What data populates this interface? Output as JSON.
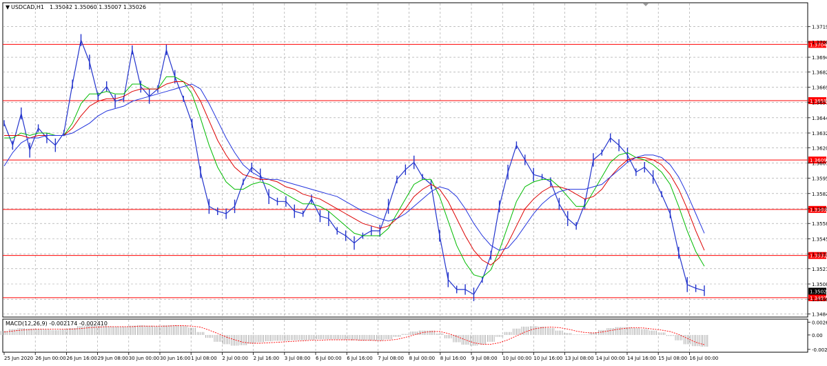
{
  "header": {
    "symbol_tf": "USDCAD,H1",
    "ohlc": "1.35042 1.35060 1.35007 1.35026"
  },
  "macd": {
    "label": "MACD(12,26,9) -0.002174 -0.002410",
    "ticks": [
      "0.002628",
      "0.00",
      "-0.00296"
    ],
    "tick_values": [
      0.002628,
      0.0,
      -0.00296
    ],
    "ylim": [
      -0.0034,
      0.0031
    ]
  },
  "colors": {
    "price": "#2233cc",
    "ma_fast": "#00bb00",
    "ma_mid": "#dd0000",
    "ma_slow": "#2233dd",
    "level": "#ff0000",
    "macd_line": "#ff0000",
    "macd_hist": "#9a9a9a",
    "grid": "#9a9a9a"
  },
  "chart_data": {
    "type": "line",
    "symbol": "USDCAD",
    "timeframe": "H1",
    "ylim": [
      1.3482,
      1.3738
    ],
    "y_ticks": [
      "1.37190",
      "1.37065",
      "1.36940",
      "1.36820",
      "1.36695",
      "1.36570",
      "1.36445",
      "1.36320",
      "1.36200",
      "1.36075",
      "1.35950",
      "1.35825",
      "1.35700",
      "1.35580",
      "1.35455",
      "1.35330",
      "1.35210",
      "1.35085",
      "1.34960",
      "1.34840"
    ],
    "y_tick_values": [
      1.3719,
      1.37065,
      1.3694,
      1.3682,
      1.36695,
      1.3657,
      1.36445,
      1.3632,
      1.362,
      1.36075,
      1.3595,
      1.35825,
      1.357,
      1.3558,
      1.35455,
      1.3533,
      1.3521,
      1.35085,
      1.3496,
      1.3484
    ],
    "x_ticks": [
      "25 Jun 2020",
      "26 Jun 00:00",
      "26 Jun 16:00",
      "29 Jun 08:00",
      "30 Jun 00:00",
      "30 Jun 16:00",
      "1 Jul 08:00",
      "2 Jul 00:00",
      "2 Jul 16:00",
      "3 Jul 08:00",
      "6 Jul 00:00",
      "6 Jul 16:00",
      "7 Jul 08:00",
      "8 Jul 00:00",
      "8 Jul 16:00",
      "9 Jul 08:00",
      "10 Jul 00:00",
      "10 Jul 16:00",
      "13 Jul 08:00",
      "14 Jul 00:00",
      "14 Jul 16:00",
      "15 Jul 08:00",
      "16 Jul 00:00"
    ],
    "levels": [
      {
        "label": "1.37045",
        "value": 1.37045
      },
      {
        "label": "1.36585",
        "value": 1.36585
      },
      {
        "label": "1.36099",
        "value": 1.36099
      },
      {
        "label": "1.35695",
        "value": 1.35695
      },
      {
        "label": "1.35318",
        "value": 1.35318
      },
      {
        "label": "1.34973",
        "value": 1.34973
      }
    ],
    "current_price": {
      "label": "1.35026",
      "value": 1.35026
    },
    "series": [
      {
        "values": [
          1.364,
          1.3622,
          1.3648,
          1.3618,
          1.3636,
          1.3628,
          1.3622,
          1.3632,
          1.3672,
          1.3708,
          1.369,
          1.3662,
          1.367,
          1.3658,
          1.366,
          1.37,
          1.367,
          1.3662,
          1.3668,
          1.37,
          1.3678,
          1.366,
          1.364,
          1.36,
          1.3572,
          1.3568,
          1.3566,
          1.3572,
          1.3592,
          1.3604,
          1.3598,
          1.358,
          1.3576,
          1.3576,
          1.3568,
          1.3566,
          1.3578,
          1.3564,
          1.3562,
          1.3552,
          1.3548,
          1.3542,
          1.3548,
          1.3552,
          1.3552,
          1.3572,
          1.3594,
          1.3602,
          1.3608,
          1.3596,
          1.359,
          1.3548,
          1.3512,
          1.3504,
          1.3504,
          1.35,
          1.3512,
          1.3532,
          1.3572,
          1.36,
          1.3622,
          1.361,
          1.3598,
          1.3596,
          1.3592,
          1.3574,
          1.3562,
          1.3556,
          1.3574,
          1.361,
          1.3616,
          1.3628,
          1.3622,
          1.3614,
          1.36,
          1.3604,
          1.3596,
          1.3582,
          1.3566,
          1.3534,
          1.3508,
          1.3505,
          1.3503
        ]
      },
      {
        "values": [
          1.3628,
          1.3628,
          1.3632,
          1.363,
          1.3632,
          1.3632,
          1.363,
          1.363,
          1.364,
          1.3656,
          1.3664,
          1.3664,
          1.3666,
          1.3664,
          1.3664,
          1.3672,
          1.3672,
          1.3668,
          1.3668,
          1.3678,
          1.3678,
          1.3674,
          1.3664,
          1.3644,
          1.3622,
          1.3604,
          1.3592,
          1.3586,
          1.3586,
          1.359,
          1.3592,
          1.359,
          1.3586,
          1.3582,
          1.3578,
          1.3574,
          1.3574,
          1.3572,
          1.3568,
          1.3562,
          1.3556,
          1.355,
          1.3548,
          1.3548,
          1.3548,
          1.3554,
          1.3566,
          1.3578,
          1.359,
          1.3594,
          1.3594,
          1.358,
          1.356,
          1.354,
          1.3526,
          1.3516,
          1.3514,
          1.352,
          1.3536,
          1.3556,
          1.3576,
          1.3588,
          1.3592,
          1.3594,
          1.3594,
          1.3588,
          1.358,
          1.3572,
          1.3572,
          1.3584,
          1.3596,
          1.3608,
          1.3614,
          1.3616,
          1.3612,
          1.361,
          1.3606,
          1.36,
          1.359,
          1.3572,
          1.3552,
          1.3535,
          1.3523
        ]
      },
      {
        "values": [
          1.363,
          1.363,
          1.363,
          1.3628,
          1.363,
          1.363,
          1.363,
          1.363,
          1.3636,
          1.3646,
          1.3654,
          1.3658,
          1.366,
          1.366,
          1.3662,
          1.3666,
          1.3668,
          1.3668,
          1.3668,
          1.3672,
          1.3674,
          1.3674,
          1.367,
          1.3658,
          1.3642,
          1.3626,
          1.3614,
          1.3604,
          1.3598,
          1.3596,
          1.3594,
          1.3594,
          1.3592,
          1.3588,
          1.3586,
          1.3582,
          1.358,
          1.3578,
          1.3574,
          1.357,
          1.3566,
          1.3562,
          1.3558,
          1.3556,
          1.3554,
          1.3556,
          1.3562,
          1.357,
          1.358,
          1.3586,
          1.359,
          1.3586,
          1.3576,
          1.3562,
          1.3548,
          1.3536,
          1.3528,
          1.3524,
          1.353,
          1.3542,
          1.3556,
          1.357,
          1.3578,
          1.3584,
          1.3588,
          1.3588,
          1.3586,
          1.3582,
          1.3578,
          1.358,
          1.3586,
          1.3596,
          1.3604,
          1.361,
          1.3612,
          1.3612,
          1.361,
          1.3606,
          1.3598,
          1.3586,
          1.357,
          1.3552,
          1.3536
        ]
      },
      {
        "values": [
          1.3605,
          1.3616,
          1.3624,
          1.3628,
          1.3628,
          1.363,
          1.363,
          1.363,
          1.3632,
          1.3636,
          1.364,
          1.3646,
          1.365,
          1.3652,
          1.3654,
          1.3658,
          1.366,
          1.3662,
          1.3664,
          1.3666,
          1.3668,
          1.367,
          1.3672,
          1.3668,
          1.3656,
          1.3642,
          1.3628,
          1.3616,
          1.3606,
          1.36,
          1.3596,
          1.3594,
          1.3594,
          1.3592,
          1.359,
          1.3588,
          1.3586,
          1.3584,
          1.3582,
          1.358,
          1.3576,
          1.3572,
          1.3568,
          1.3565,
          1.3562,
          1.356,
          1.3562,
          1.3566,
          1.3572,
          1.3578,
          1.3584,
          1.3588,
          1.3586,
          1.358,
          1.357,
          1.3558,
          1.3548,
          1.354,
          1.3536,
          1.3538,
          1.3546,
          1.3556,
          1.3566,
          1.3574,
          1.358,
          1.3584,
          1.3586,
          1.3586,
          1.3586,
          1.3588,
          1.359,
          1.3596,
          1.3602,
          1.3608,
          1.3612,
          1.3614,
          1.3614,
          1.3612,
          1.3606,
          1.3596,
          1.3582,
          1.3566,
          1.355
        ]
      }
    ],
    "macd_hist": [
      0.0008,
      0.0012,
      0.0014,
      0.0013,
      0.0012,
      0.0011,
      0.001,
      0.0011,
      0.0014,
      0.0018,
      0.002,
      0.0019,
      0.0018,
      0.0017,
      0.0017,
      0.0019,
      0.002,
      0.0019,
      0.0018,
      0.002,
      0.002,
      0.0019,
      0.0015,
      0.0006,
      -0.0006,
      -0.0014,
      -0.0019,
      -0.0022,
      -0.0021,
      -0.0018,
      -0.0015,
      -0.0013,
      -0.0012,
      -0.0012,
      -0.0011,
      -0.0011,
      -0.001,
      -0.0009,
      -0.0009,
      -0.0009,
      -0.001,
      -0.0011,
      -0.0012,
      -0.0012,
      -0.0012,
      -0.0009,
      -0.0004,
      0.0002,
      0.0007,
      0.0009,
      0.0009,
      0.0003,
      -0.0007,
      -0.0015,
      -0.002,
      -0.0022,
      -0.002,
      -0.0014,
      -0.0004,
      0.0006,
      0.0013,
      0.0017,
      0.0018,
      0.0017,
      0.0014,
      0.0009,
      0.0004,
      0.0001,
      0.0001,
      0.0005,
      0.001,
      0.0014,
      0.0016,
      0.0016,
      0.0014,
      0.0012,
      0.0009,
      0.0005,
      -0.0002,
      -0.0011,
      -0.0019,
      -0.0023,
      -0.0024
    ],
    "macd_signal": [
      0.0006,
      0.0008,
      0.001,
      0.0011,
      0.0012,
      0.0012,
      0.0012,
      0.0012,
      0.0012,
      0.0013,
      0.0015,
      0.0016,
      0.0017,
      0.0017,
      0.0017,
      0.0017,
      0.0018,
      0.0018,
      0.0018,
      0.0018,
      0.0019,
      0.0019,
      0.0018,
      0.0016,
      0.001,
      0.0003,
      -0.0004,
      -0.001,
      -0.0015,
      -0.0017,
      -0.0017,
      -0.0016,
      -0.0015,
      -0.0014,
      -0.0013,
      -0.0012,
      -0.0011,
      -0.0011,
      -0.001,
      -0.001,
      -0.001,
      -0.001,
      -0.0011,
      -0.0011,
      -0.0012,
      -0.0011,
      -0.0009,
      -0.0005,
      0.0,
      0.0005,
      0.0007,
      0.0007,
      0.0003,
      -0.0003,
      -0.001,
      -0.0016,
      -0.0019,
      -0.0019,
      -0.0016,
      -0.001,
      -0.0002,
      0.0006,
      0.0012,
      0.0015,
      0.0016,
      0.0015,
      0.0012,
      0.0008,
      0.0005,
      0.0004,
      0.0006,
      0.0009,
      0.0012,
      0.0014,
      0.0015,
      0.0014,
      0.0012,
      0.001,
      0.0007,
      0.0001,
      -0.0007,
      -0.0015,
      -0.002
    ]
  }
}
